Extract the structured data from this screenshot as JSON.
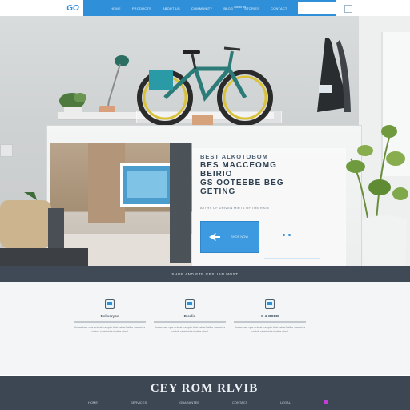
{
  "nav": {
    "logo": "GO",
    "links": [
      "HOME",
      "PRODUCTS",
      "ABOUT US",
      "COMMUNITY",
      "BLOG",
      "STORIES",
      "CONTACT"
    ],
    "action_label": "SIGN IN"
  },
  "hero": {
    "title_line1": "BEST ALKOTOBOM",
    "title_line2": "BES MACCEOMG BEIRIO",
    "title_line3": "GS OOTEEBE BEG GETING",
    "subtitle": "AVTHS OF DRIVEN MIRTS OF THE RATE",
    "cta_label": "SHOP NOW"
  },
  "band": {
    "text": "SHOP AND ETE GESLIAN MOST"
  },
  "features": [
    {
      "title": "Deliverybe",
      "text": "Aseesiven ope eutnat caeqrlo thet retrei ltetbe aeeoriaa cartvb ceretbnt soloebe eteci"
    },
    {
      "title": "Biselio",
      "text": "Aseesiven ope eutnat caeqrlo thet retrei ltetbe aeeoriaa cartvb ceretbnt soloebe eteci"
    },
    {
      "title": "O & BBBB",
      "text": "Aseesiven ope eutnat caeqrlo thet retrei ltetbe aeeoriaa cartvb ceretbnt soloebe eteci"
    }
  ],
  "footer": {
    "title": "CEY ROM RLVIB",
    "links": [
      "HOME",
      "SERVICES",
      "GUARANTEE",
      "CONTACT",
      "LEGAL"
    ]
  },
  "colors": {
    "accent": "#2f8fd8",
    "band": "#3f4a56",
    "footer": "#3d4753",
    "feature_bg": "#f4f5f6"
  }
}
